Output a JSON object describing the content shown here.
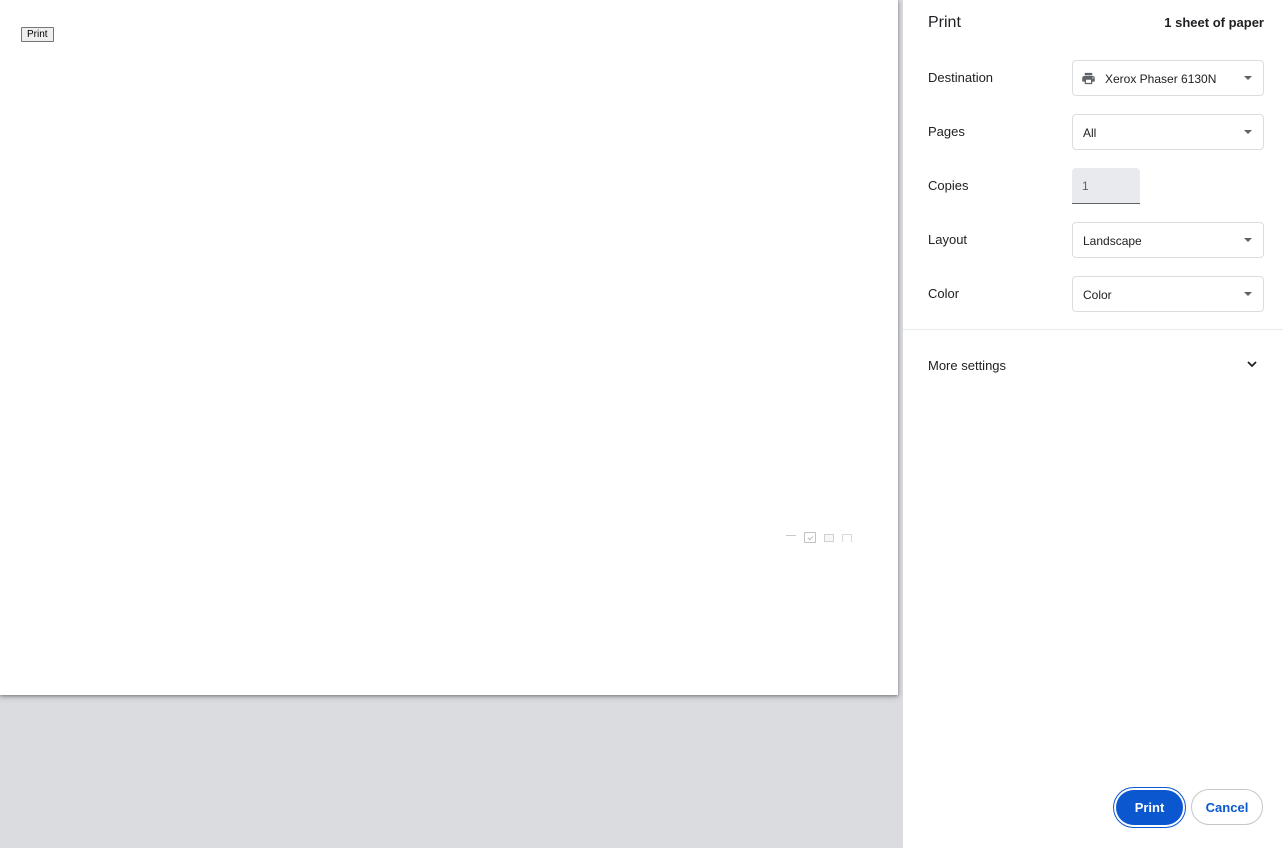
{
  "preview": {
    "page_button_label": "Print"
  },
  "sidebar": {
    "title": "Print",
    "sheet_count": "1 sheet of paper",
    "destination": {
      "label": "Destination",
      "value": "Xerox Phaser 6130N",
      "icon": "printer-icon"
    },
    "pages": {
      "label": "Pages",
      "value": "All"
    },
    "copies": {
      "label": "Copies",
      "value": "1"
    },
    "layout": {
      "label": "Layout",
      "value": "Landscape"
    },
    "color": {
      "label": "Color",
      "value": "Color"
    },
    "more_settings": {
      "label": "More settings",
      "icon": "chevron-down-icon"
    },
    "buttons": {
      "print": "Print",
      "cancel": "Cancel"
    }
  },
  "colors": {
    "accent": "#0b57d0",
    "preview_background": "#dadce0",
    "copies_field_bg": "#e8eaed"
  }
}
